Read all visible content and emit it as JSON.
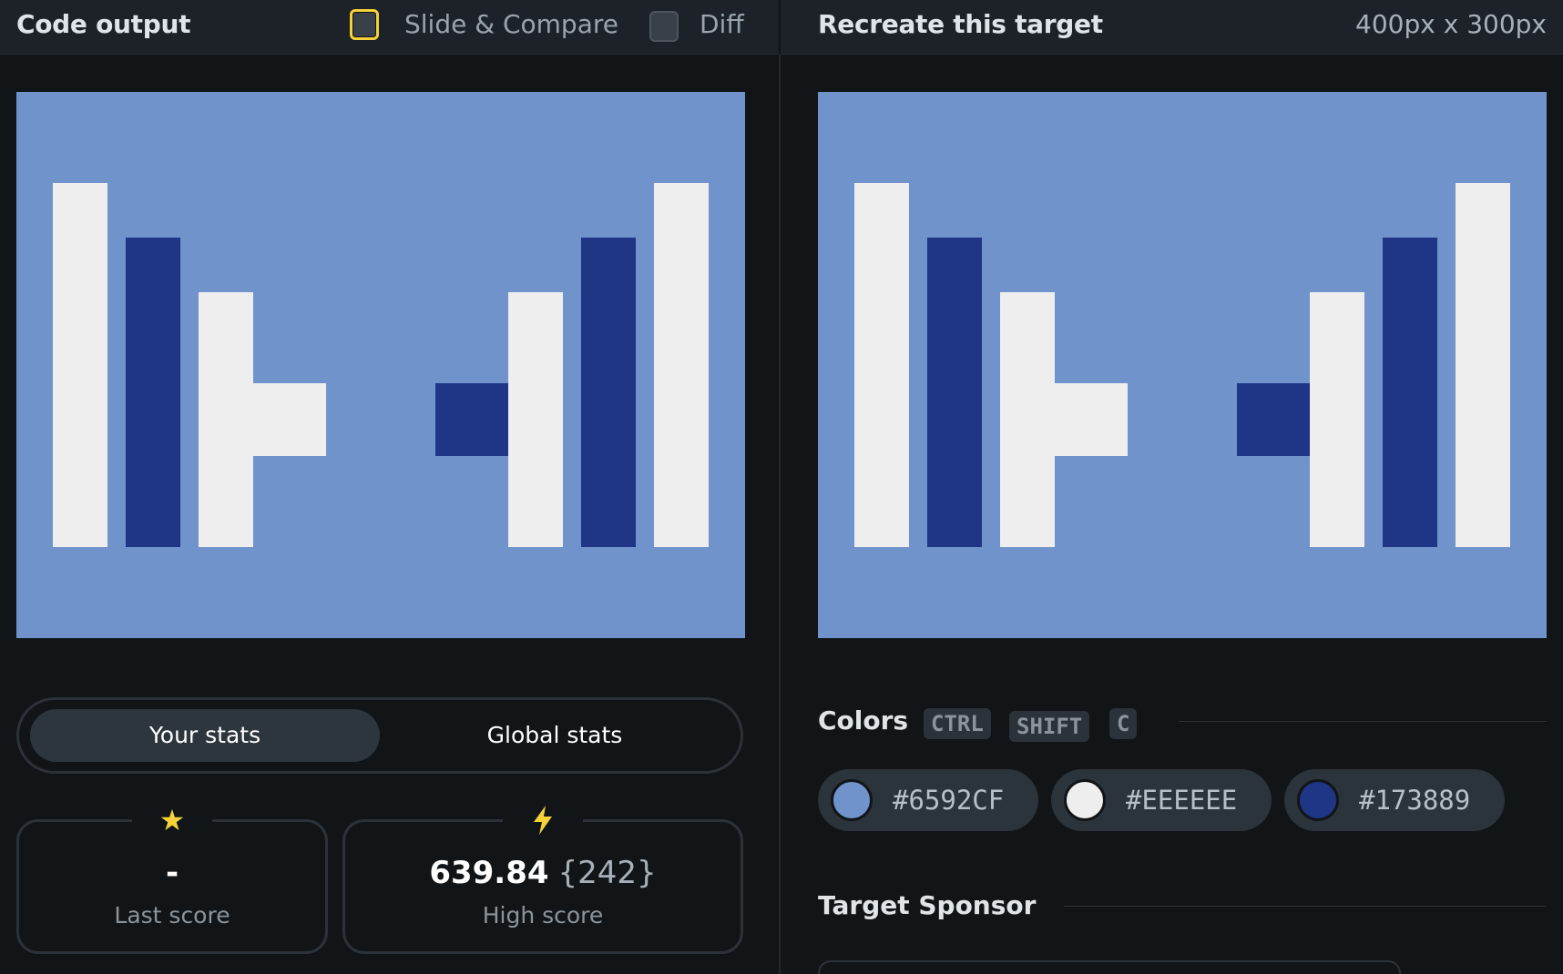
{
  "header": {
    "left_title": "Code output",
    "slide_compare_label": "Slide & Compare",
    "diff_label": "Diff",
    "right_title": "Recreate this target",
    "dimensions": "400px x 300px"
  },
  "stats": {
    "tab_your": "Your stats",
    "tab_global": "Global stats",
    "last_score_icon": "star-icon",
    "last_score_value": "-",
    "last_score_label": "Last score",
    "high_score_icon": "lightning-icon",
    "high_score_value": "639.84",
    "high_score_sub": "{242}",
    "high_score_label": "High score"
  },
  "colors": {
    "title": "Colors",
    "shortcut": [
      "CTRL",
      "SHIFT",
      "C"
    ],
    "swatches": [
      {
        "hex": "#6592CF",
        "color": "#6f93ca"
      },
      {
        "hex": "#EEEEEE",
        "color": "#eeeeee"
      },
      {
        "hex": "#173889",
        "color": "#1f3585"
      }
    ]
  },
  "sponsor": {
    "title": "Target Sponsor"
  }
}
